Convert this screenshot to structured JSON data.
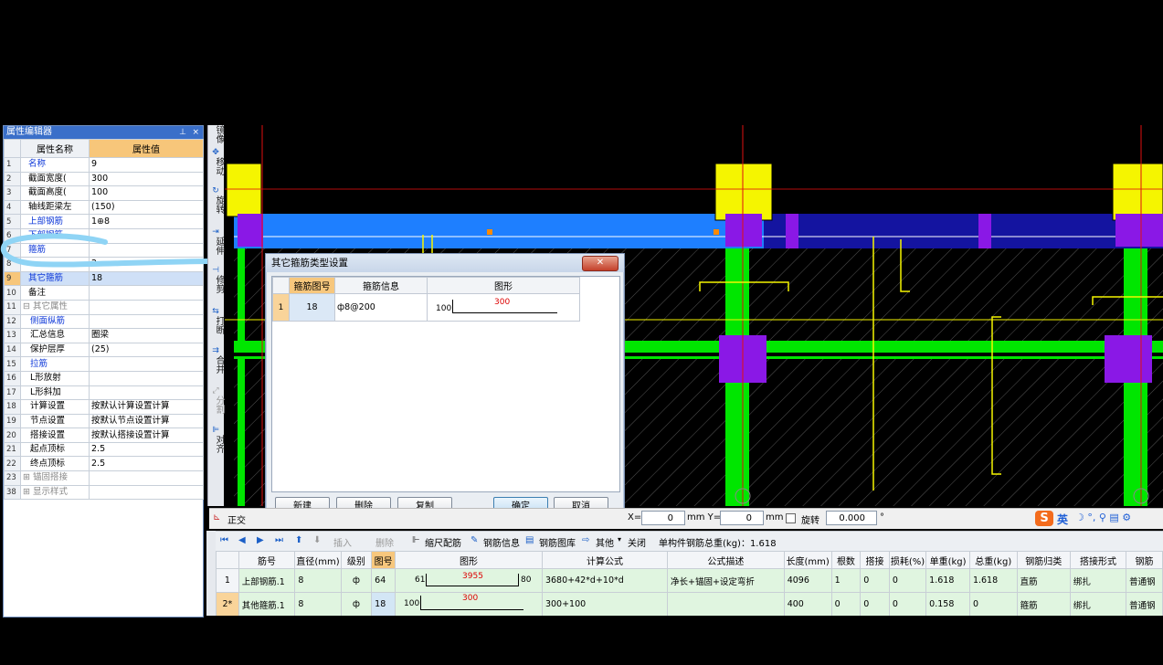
{
  "property_editor": {
    "title": "属性编辑器",
    "pin_label": "⊥",
    "close_label": "×",
    "col_name": "属性名称",
    "col_value": "属性值",
    "rows": [
      {
        "num": "1",
        "name": "名称",
        "value": "9"
      },
      {
        "num": "2",
        "name": "截面宽度(",
        "value": "300"
      },
      {
        "num": "3",
        "name": "截面高度(",
        "value": "100"
      },
      {
        "num": "4",
        "name": "轴线距梁左",
        "value": "(150)"
      },
      {
        "num": "5",
        "name": "上部钢筋",
        "value": "1⊕8"
      },
      {
        "num": "6",
        "name": "下部钢筋",
        "value": ""
      },
      {
        "num": "7",
        "name": "箍筋",
        "value": ""
      },
      {
        "num": "8",
        "name": "",
        "value": "2"
      },
      {
        "num": "9",
        "name": "其它箍筋",
        "value": "18"
      },
      {
        "num": "10",
        "name": "备注",
        "value": ""
      },
      {
        "num": "11",
        "name": "⊟ 其它属性",
        "value": ""
      },
      {
        "num": "12",
        "name": "侧面纵筋",
        "value": ""
      },
      {
        "num": "13",
        "name": "汇总信息",
        "value": "圈梁"
      },
      {
        "num": "14",
        "name": "保护层厚",
        "value": "(25)"
      },
      {
        "num": "15",
        "name": "拉筋",
        "value": ""
      },
      {
        "num": "16",
        "name": "L形放射",
        "value": ""
      },
      {
        "num": "17",
        "name": "L形斜加",
        "value": ""
      },
      {
        "num": "18",
        "name": "计算设置",
        "value": "按默认计算设置计算"
      },
      {
        "num": "19",
        "name": "节点设置",
        "value": "按默认节点设置计算"
      },
      {
        "num": "20",
        "name": "搭接设置",
        "value": "按默认搭接设置计算"
      },
      {
        "num": "21",
        "name": "起点顶标",
        "value": "2.5"
      },
      {
        "num": "22",
        "name": "终点顶标",
        "value": "2.5"
      },
      {
        "num": "23",
        "name": "⊞ 锚固搭接",
        "value": ""
      },
      {
        "num": "38",
        "name": "⊞ 显示样式",
        "value": ""
      }
    ]
  },
  "vertical_toolbar": [
    {
      "label": "镜像",
      "icon": "mirror-icon"
    },
    {
      "label": "移动",
      "icon": "move-icon"
    },
    {
      "label": "旋转",
      "icon": "rotate-icon"
    },
    {
      "label": "延伸",
      "icon": "extend-icon"
    },
    {
      "label": "修剪",
      "icon": "trim-icon"
    },
    {
      "label": "打断",
      "icon": "break-icon"
    },
    {
      "label": "合并",
      "icon": "merge-icon"
    },
    {
      "label": "分割",
      "icon": "split-icon"
    },
    {
      "label": "对齐",
      "icon": "align-icon"
    }
  ],
  "dialog": {
    "title": "其它箍筋类型设置",
    "close_label": "✕",
    "columns": [
      "箍筋图号",
      "箍筋信息",
      "图形"
    ],
    "row": {
      "num": "1",
      "code": "18",
      "info": "ф8@200",
      "shape_left": "100",
      "shape_len": "300"
    },
    "buttons": {
      "new": "新建",
      "delete": "删除",
      "copy": "复制",
      "ok": "确定",
      "cancel": "取消"
    }
  },
  "coord_bar": {
    "ortho": "正交",
    "x_label": "X=",
    "x_value": "0",
    "y_label": "mm Y=",
    "y_value": "0",
    "unit": "mm",
    "rotate_label": "旋转",
    "rotate_value": "0.000",
    "degree": "°",
    "ime": "英"
  },
  "rebar_toolbar": {
    "insert": "插入",
    "delete": "删除",
    "scale_config": "缩尺配筋",
    "rebar_info": "钢筋信息",
    "rebar_library": "钢筋图库",
    "other": "其他",
    "close": "关闭",
    "total_weight": "单构件钢筋总重(kg)：1.618"
  },
  "rebar_table": {
    "columns": [
      "筋号",
      "直径(mm)",
      "级别",
      "图号",
      "图形",
      "计算公式",
      "公式描述",
      "长度(mm)",
      "根数",
      "搭接",
      "损耗(%)",
      "单重(kg)",
      "总重(kg)",
      "钢筋归类",
      "搭接形式",
      "钢筋"
    ],
    "rows": [
      {
        "rowno": "1",
        "name": "上部钢筋.1",
        "dia": "8",
        "grade": "ф",
        "code": "64",
        "shape_left": "61",
        "shape_len": "3955",
        "shape_right": "80",
        "formula": "3680+42*d+10*d",
        "desc": "净长+锚固+设定弯折",
        "length": "4096",
        "count": "1",
        "lap": "0",
        "loss": "0",
        "unit_w": "1.618",
        "total_w": "1.618",
        "category": "直筋",
        "lap_type": "绑扎",
        "type": "普通钢"
      },
      {
        "rowno": "2*",
        "name": "其他箍筋.1",
        "dia": "8",
        "grade": "ф",
        "code": "18",
        "shape_left": "100",
        "shape_len": "300",
        "shape_right": "",
        "formula": "300+100",
        "desc": "",
        "length": "400",
        "count": "0",
        "lap": "0",
        "loss": "0",
        "unit_w": "0.158",
        "total_w": "0",
        "category": "箍筋",
        "lap_type": "绑扎",
        "type": "普通钢"
      }
    ]
  },
  "colors": {
    "beam_blue": "#1e7fff",
    "beam_navy": "#1414a0",
    "rebar_green": "#00e600",
    "column_yellow": "#f5f500",
    "node_purple": "#8a18e6",
    "axis_red": "#e01010",
    "annotation_cyan": "#8fd4f5"
  }
}
